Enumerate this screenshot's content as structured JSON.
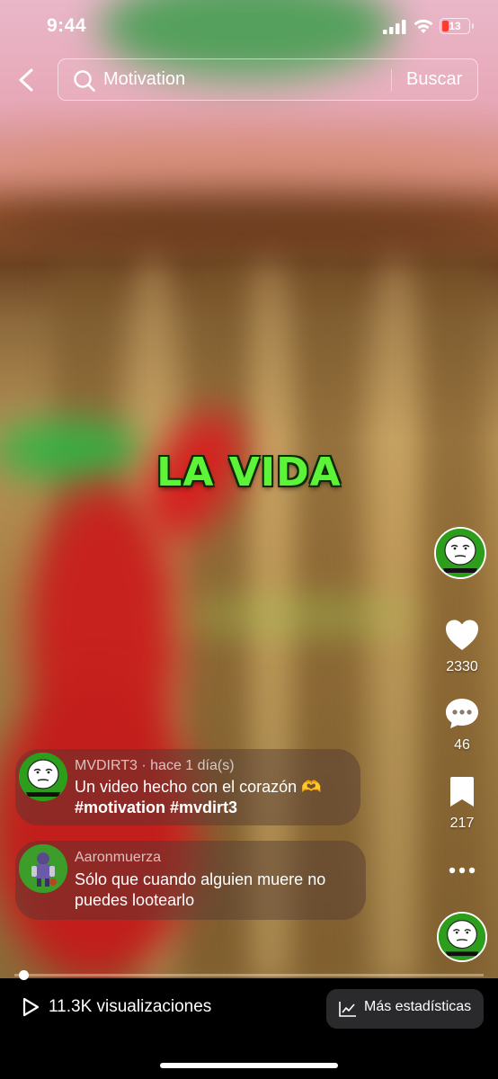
{
  "status_bar": {
    "time": "9:44",
    "battery": "13"
  },
  "search": {
    "query": "Motivation",
    "action_label": "Buscar"
  },
  "video": {
    "overlay_text": "LA VIDA"
  },
  "rail": {
    "likes": "2330",
    "comments": "46",
    "saves": "217"
  },
  "comments": [
    {
      "meta": "MVDIRT3 · hace 1 día(s)",
      "text": "Un video hecho con el corazón 🫶",
      "tags": "#motivation #mvdirt3"
    },
    {
      "meta": "Aaronmuerza",
      "line1": "Sólo que cuando alguien muere no",
      "line2": "puedes lootearlo"
    }
  ],
  "playback": {
    "progress": 0.01
  },
  "footer": {
    "views": "11.3K visualizaciones",
    "stats_label": "Más estadísticas"
  },
  "icons": [
    "back-icon",
    "search-icon",
    "heart-icon",
    "comment-icon",
    "bookmark-icon",
    "more-icon",
    "play-icon",
    "chart-icon"
  ],
  "colors": {
    "overlay_text": "#5cf338",
    "bottom_bar": "#000000",
    "stats_button": "#2a2a2c"
  }
}
